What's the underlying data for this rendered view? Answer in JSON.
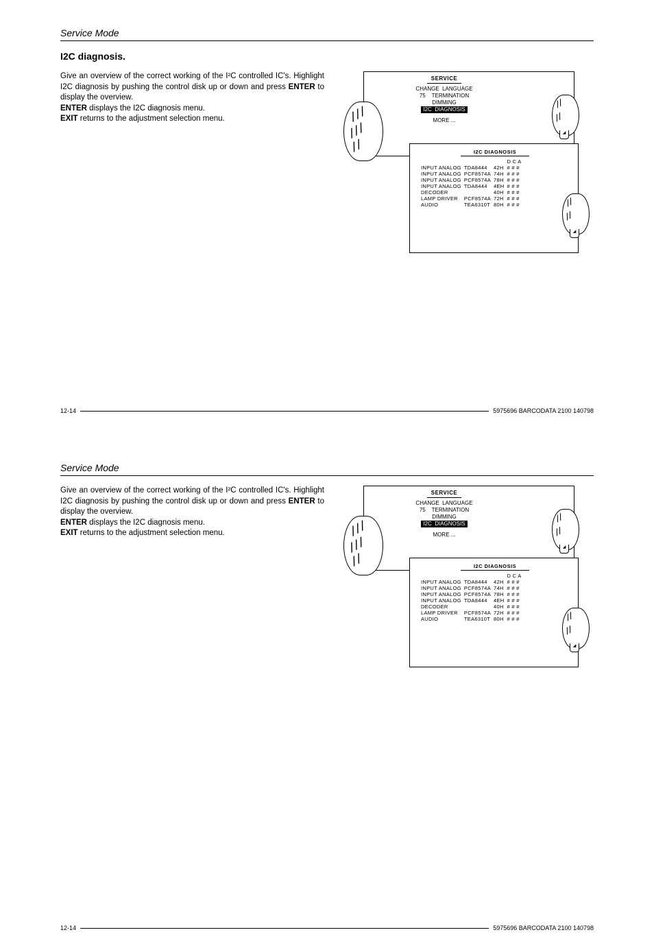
{
  "header": {
    "title": "Service Mode"
  },
  "section": {
    "title": "I2C diagnosis."
  },
  "body": {
    "p1a": "Give an overview of the correct working of the I²C controlled IC's. Highlight I2C diagnosis by pushing the control disk up or down and press ",
    "enter1": "ENTER",
    "p1b": " to display the overview.",
    "p2a": "ENTER",
    "p2b": " displays the I2C diagnosis menu.",
    "p3a": "EXIT",
    "p3b": " returns to the adjustment selection menu."
  },
  "menu": {
    "title": "SERVICE",
    "line1": "CHANGE  LANGUAGE",
    "line2_left": "75",
    "line2_right": "TERMINATION",
    "line3": "DIMMING",
    "highlight": "I2C  DIAGNOSIS",
    "more": "MORE ..."
  },
  "diag": {
    "title": "I2C  DIAGNOSIS",
    "dca": "D C A",
    "rows": [
      {
        "c1": "INPUT  ANALOG",
        "c2": "TDA8444",
        "c3": "42H",
        "c4": "# # #"
      },
      {
        "c1": "INPUT  ANALOG",
        "c2": "PCF8574A",
        "c3": "74H",
        "c4": "# # #"
      },
      {
        "c1": "INPUT  ANALOG",
        "c2": "PCF8574A",
        "c3": "78H",
        "c4": "# # #"
      },
      {
        "c1": "INPUT  ANALOG",
        "c2": "TDA8444",
        "c3": "4EH",
        "c4": "# # #"
      },
      {
        "c1": "DECODER",
        "c2": "",
        "c3": "40H",
        "c4": "# # #"
      },
      {
        "c1": "LAMP  DRIVER",
        "c2": "PCF8574A",
        "c3": "72H",
        "c4": "# # #"
      },
      {
        "c1": "AUDIO",
        "c2": "TEA6310T",
        "c3": "80H",
        "c4": "# # #"
      }
    ]
  },
  "footer": {
    "left": "12-14",
    "right": "5975696 BARCODATA 2100 140798"
  }
}
